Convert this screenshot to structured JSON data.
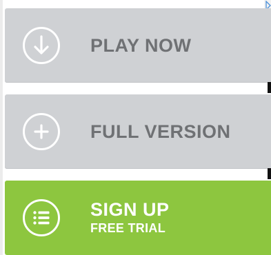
{
  "buttons": {
    "play": {
      "label": "PLAY NOW",
      "icon": "download-arrow-icon"
    },
    "full": {
      "label": "FULL VERSION",
      "icon": "plus-icon"
    },
    "signup": {
      "label": "SIGN UP",
      "sublabel": "FREE TRIAL",
      "icon": "list-icon"
    }
  },
  "colors": {
    "gray_button": "#cfd1d4",
    "gray_text": "#6f7174",
    "green_button": "#8dc63f",
    "white": "#ffffff"
  },
  "ad_marker_icon": "adchoices-icon"
}
